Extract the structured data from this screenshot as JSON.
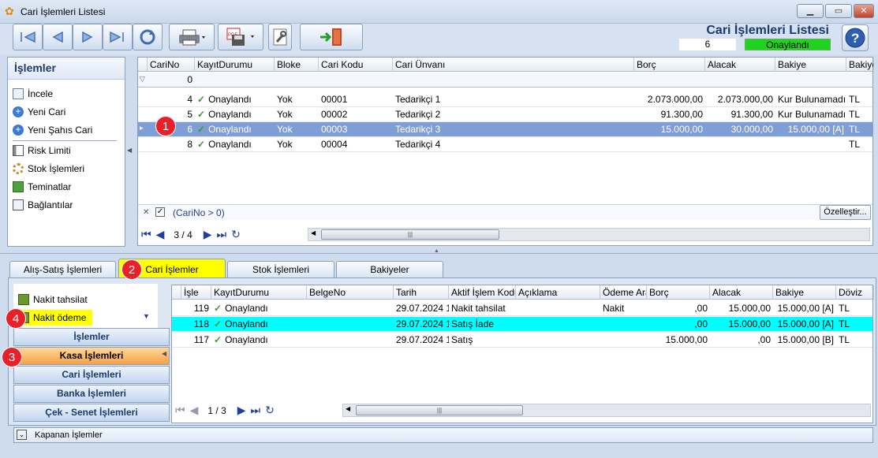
{
  "window": {
    "title": "Cari İşlemleri Listesi",
    "btn_min": "▁",
    "btn_max": "▭",
    "btn_close": "✕"
  },
  "header": {
    "title": "Cari İşlemleri Listesi",
    "count": "6",
    "status": "Onaylandı",
    "status_color": "#1fd31f"
  },
  "toolbar": {
    "icons": [
      "first-icon",
      "prev-icon",
      "next-icon",
      "last-icon",
      "refresh-icon",
      "print-icon",
      "pdf-save-icon",
      "tools-icon",
      "exit-icon",
      "help-icon"
    ]
  },
  "left_menu": {
    "title": "İşlemler",
    "items": [
      "İncele",
      "Yeni Cari",
      "Yeni Şahıs Cari",
      "Risk Limiti",
      "Stok İşlemleri",
      "Teminatlar",
      "Bağlantılar"
    ]
  },
  "main_grid": {
    "columns": [
      "CariNo",
      "KayıtDurumu",
      "Bloke",
      "Cari Kodu",
      "Cari Ünvanı",
      "Borç",
      "Alacak",
      "Bakiye",
      "Bakiye"
    ],
    "filter_cari_no": "0",
    "rows": [
      {
        "no": "4",
        "durum": "Onaylandı",
        "bloke": "Yok",
        "kod": "00001",
        "unvan": "Tedarikçi 1",
        "borc": "2.073.000,00",
        "alacak": "2.073.000,00",
        "bakiye": "Kur Bulunamadı",
        "dv": "TL"
      },
      {
        "no": "5",
        "durum": "Onaylandı",
        "bloke": "Yok",
        "kod": "00002",
        "unvan": "Tedarikçi 2",
        "borc": "91.300,00",
        "alacak": "91.300,00",
        "bakiye": "Kur Bulunamadı",
        "dv": "TL"
      },
      {
        "no": "6",
        "durum": "Onaylandı",
        "bloke": "Yok",
        "kod": "00003",
        "unvan": "Tedarikçi 3",
        "borc": "15.000,00",
        "alacak": "30.000,00",
        "bakiye": "15.000,00 [A]",
        "dv": "TL"
      },
      {
        "no": "8",
        "durum": "Onaylandı",
        "bloke": "Yok",
        "kod": "00004",
        "unvan": "Tedarikçi 4",
        "borc": "",
        "alacak": "",
        "bakiye": "",
        "dv": "TL"
      }
    ],
    "filter_text": "(CariNo > 0)",
    "customize": "Özelleştir...",
    "page": "3 / 4"
  },
  "tabs": [
    "Alış-Satış İşlemleri",
    "Cari İşlemler",
    "Stok İşlemleri",
    "Bakiyeler"
  ],
  "lower_left": {
    "actions": [
      "Nakit tahsilat",
      "Nakit ödeme"
    ],
    "groups": [
      "İşlemler",
      "Kasa İşlemleri",
      "Cari İşlemleri",
      "Banka İşlemleri",
      "Çek - Senet İşlemleri"
    ]
  },
  "lower_grid": {
    "columns": [
      "İşle",
      "KayıtDurumu",
      "BelgeNo",
      "Tarih",
      "Aktif İşlem Kodu",
      "Açıklama",
      "Ödeme Aracı",
      "Borç",
      "Alacak",
      "Bakiye",
      "Döviz"
    ],
    "rows": [
      {
        "no": "119",
        "durum": "Onaylandı",
        "belge": "",
        "tarih": "29.07.2024 1",
        "kod": "Nakit tahsilat",
        "acik": "",
        "arac": "Nakit",
        "borc": ",00",
        "alacak": "15.000,00",
        "bakiye": "15.000,00 [A]",
        "dv": "TL"
      },
      {
        "no": "118",
        "durum": "Onaylandı",
        "belge": "",
        "tarih": "29.07.2024 1",
        "kod": "Satış İade",
        "acik": "",
        "arac": "",
        "borc": ",00",
        "alacak": "15.000,00",
        "bakiye": "15.000,00 [A]",
        "dv": "TL"
      },
      {
        "no": "117",
        "durum": "Onaylandı",
        "belge": "",
        "tarih": "29.07.2024 1",
        "kod": "Satış",
        "acik": "",
        "arac": "",
        "borc": "15.000,00",
        "alacak": ",00",
        "bakiye": "15.000,00 [B]",
        "dv": "TL"
      }
    ],
    "page": "1 / 3"
  },
  "closed_ops": "Kapanan İşlemler",
  "badges": [
    "1",
    "2",
    "3",
    "4"
  ]
}
